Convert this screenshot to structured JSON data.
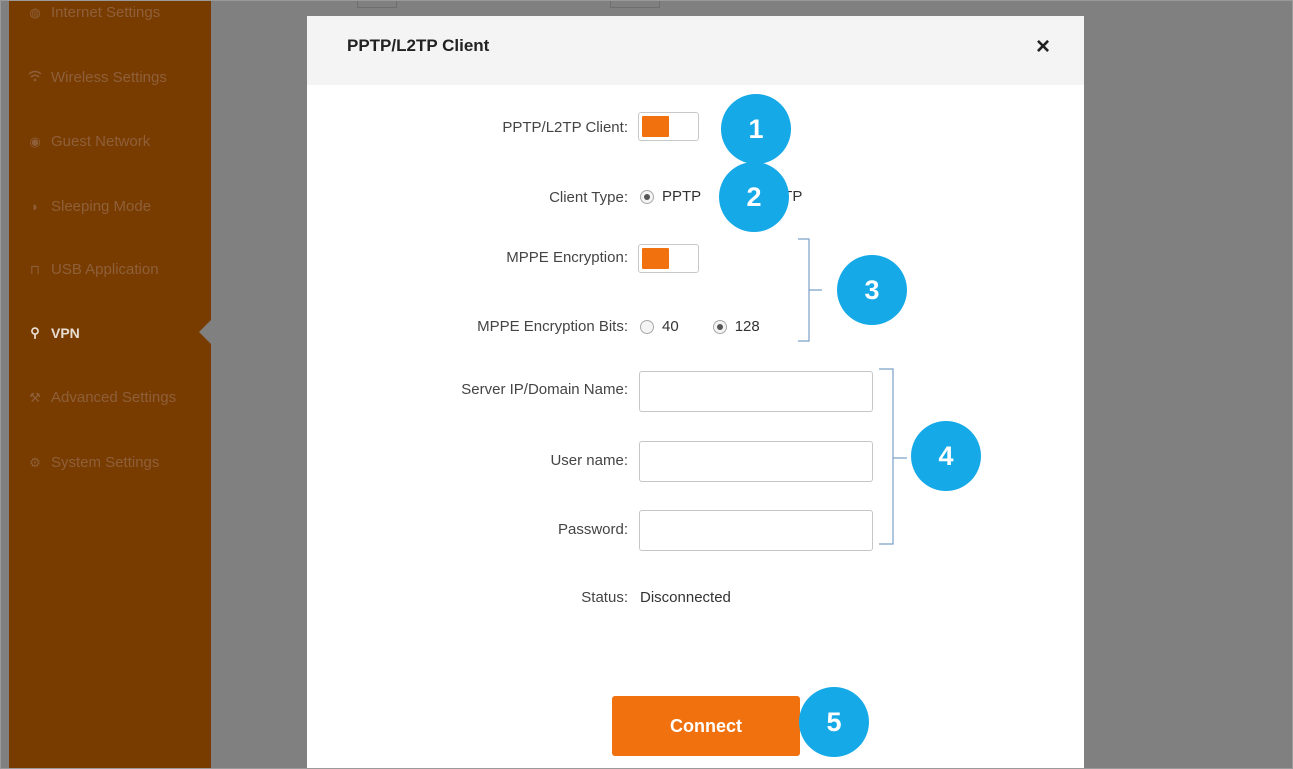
{
  "sidebar": {
    "items": [
      {
        "label": "Internet Settings",
        "icon": "globe-icon"
      },
      {
        "label": "Wireless Settings",
        "icon": "wifi-icon"
      },
      {
        "label": "Guest Network",
        "icon": "guest-icon"
      },
      {
        "label": "Sleeping Mode",
        "icon": "moon-icon"
      },
      {
        "label": "USB Application",
        "icon": "usb-icon"
      },
      {
        "label": "VPN",
        "icon": "vpn-icon",
        "active": true
      },
      {
        "label": "Advanced Settings",
        "icon": "wrench-icon"
      },
      {
        "label": "System Settings",
        "icon": "gear-icon"
      }
    ]
  },
  "modal": {
    "title": "PPTP/L2TP Client",
    "close_label": "×",
    "client": {
      "label": "PPTP/L2TP Client:",
      "enabled": true
    },
    "client_type": {
      "label": "Client Type:",
      "options": [
        "PPTP",
        "L2TP"
      ],
      "visible_texts": [
        "PPTP",
        "TP"
      ],
      "selected": "PPTP"
    },
    "mppe": {
      "label": "MPPE Encryption:",
      "enabled": true
    },
    "mppe_bits": {
      "label": "MPPE Encryption Bits:",
      "options": [
        "40",
        "128"
      ],
      "selected": "128"
    },
    "server": {
      "label": "Server IP/Domain Name:",
      "value": ""
    },
    "username": {
      "label": "User name:",
      "value": ""
    },
    "password": {
      "label": "Password:",
      "value": ""
    },
    "status": {
      "label": "Status:",
      "value": "Disconnected"
    },
    "connect_label": "Connect"
  },
  "callouts": [
    "1",
    "2",
    "3",
    "4",
    "5"
  ],
  "colors": {
    "accent_orange": "#f0710e",
    "callout_blue": "#16a9e8",
    "sidebar_brown": "#783c00",
    "overlay_gray": "#808080"
  }
}
